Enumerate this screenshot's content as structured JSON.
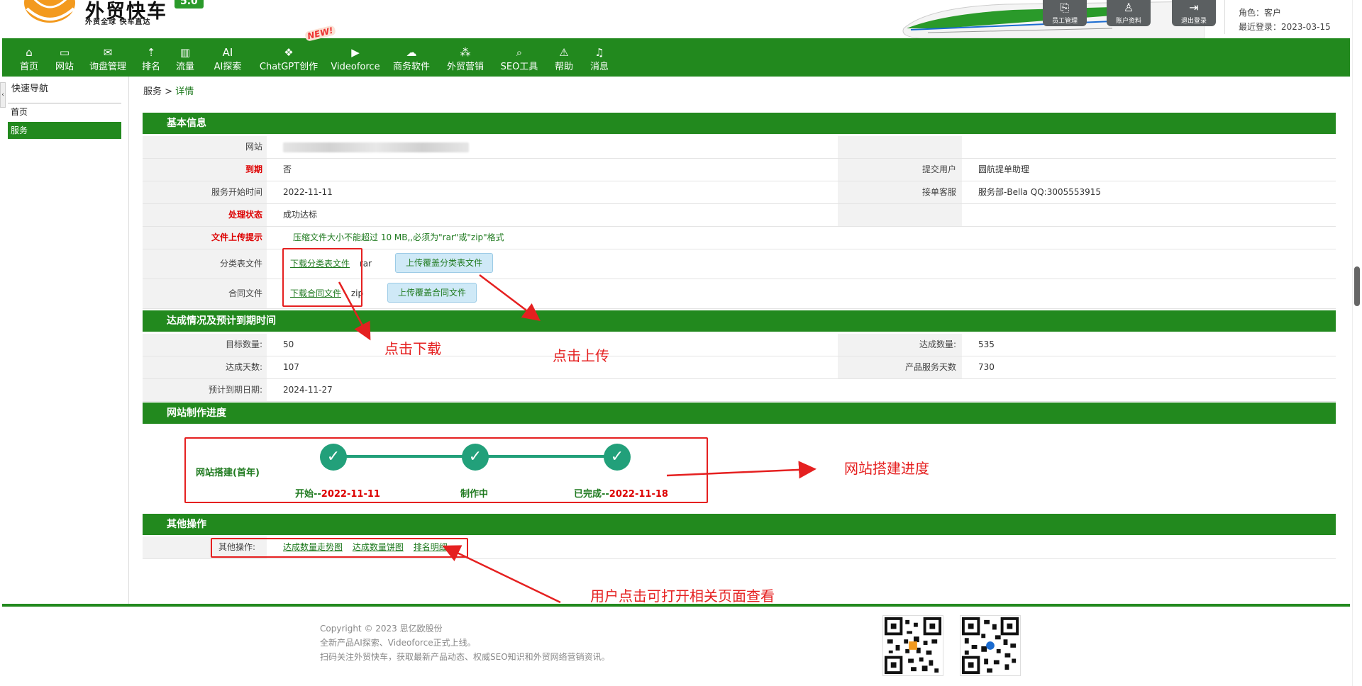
{
  "header": {
    "logo_title": "外贸快车",
    "logo_subtitle": "外贸全球 快车直达",
    "version": "5.0",
    "buttons": [
      {
        "label": "员工管理",
        "icon": "staff-icon"
      },
      {
        "label": "账户资料",
        "icon": "user-icon"
      },
      {
        "label": "退出登录",
        "icon": "logout-icon"
      }
    ],
    "role": "角色：客户",
    "last_login": "最近登录：2023-03-15"
  },
  "nav": {
    "new_badge": "NEW!",
    "items": [
      {
        "label": "首页",
        "icon": "⌂"
      },
      {
        "label": "网站",
        "icon": "▭"
      },
      {
        "label": "询盘管理",
        "icon": "✉"
      },
      {
        "label": "排名",
        "icon": "⇡"
      },
      {
        "label": "流量",
        "icon": "▥"
      },
      {
        "label": "AI探索",
        "icon": "AI"
      },
      {
        "label": "ChatGPT创作",
        "icon": "❖"
      },
      {
        "label": "Videoforce",
        "icon": "▶"
      },
      {
        "label": "商务软件",
        "icon": "☁"
      },
      {
        "label": "外贸营销",
        "icon": "⁂"
      },
      {
        "label": "SEO工具",
        "icon": "⌕"
      },
      {
        "label": "帮助",
        "icon": "⚠"
      },
      {
        "label": "消息",
        "icon": "♫"
      }
    ]
  },
  "sidebar": {
    "title": "快速导航",
    "collapse": "‹",
    "items": [
      {
        "label": "首页"
      },
      {
        "label": "服务"
      }
    ]
  },
  "breadcrumb": {
    "parent": "服务",
    "sep": " > ",
    "current": "详情"
  },
  "basic": {
    "title": "基本信息",
    "website_label": "网站",
    "expire_label": "到期",
    "expire_value": "否",
    "submitter_label": "提交用户",
    "submitter_value": "圆航提单助理",
    "start_label": "服务开始时间",
    "start_value": "2022-11-11",
    "cs_label": "接单客服",
    "cs_value": "服务部-Bella QQ:3005553915",
    "status_label": "处理状态",
    "status_value": "成功达标",
    "upload_hint_label": "文件上传提示",
    "upload_hint_value": "压缩文件大小不能超过 10 MB,,必须为\"rar\"或\"zip\"格式",
    "class_label": "分类表文件",
    "class_link": "下载分类表文件",
    "class_ext": "rar",
    "class_upload": "上传覆盖分类表文件",
    "contract_label": "合同文件",
    "contract_link": "下载合同文件",
    "contract_ext": "zip",
    "contract_upload": "上传覆盖合同文件"
  },
  "achieve": {
    "title": "达成情况及预计到期时间",
    "target_label": "目标数量:",
    "target_value": "50",
    "reached_label": "达成数量:",
    "reached_value": "535",
    "days_label": "达成天数:",
    "days_value": "107",
    "service_days_label": "产品服务天数",
    "service_days_value": "730",
    "expected_label": "预计到期日期:",
    "expected_value": "2024-11-27"
  },
  "progress": {
    "title": "网站制作进度",
    "label": "网站搭建(首年)",
    "steps": [
      {
        "prefix": "开始--",
        "date": "2022-11-11"
      },
      {
        "prefix": "制作中",
        "date": ""
      },
      {
        "prefix": "已完成--",
        "date": "2022-11-18"
      }
    ]
  },
  "other": {
    "title": "其他操作",
    "label": "其他操作:",
    "links": [
      "达成数量走势图",
      "达成数量饼图",
      "排名明细"
    ]
  },
  "annotations": {
    "download": "点击下载",
    "upload": "点击上传",
    "progress": "网站搭建进度",
    "open": "用户点击可打开相关页面查看"
  },
  "footer": {
    "copyright": "Copyright © 2023 思亿欧股份",
    "line2": "全新产品AI探索、Videoforce正式上线。",
    "line3": "扫码关注外贸快车，获取最新产品动态、权威SEO知识和外贸网络营销资讯。"
  },
  "colors": {
    "brand_green": "#22891e",
    "annotation_red": "#e52020",
    "step_teal": "#22a07a"
  }
}
